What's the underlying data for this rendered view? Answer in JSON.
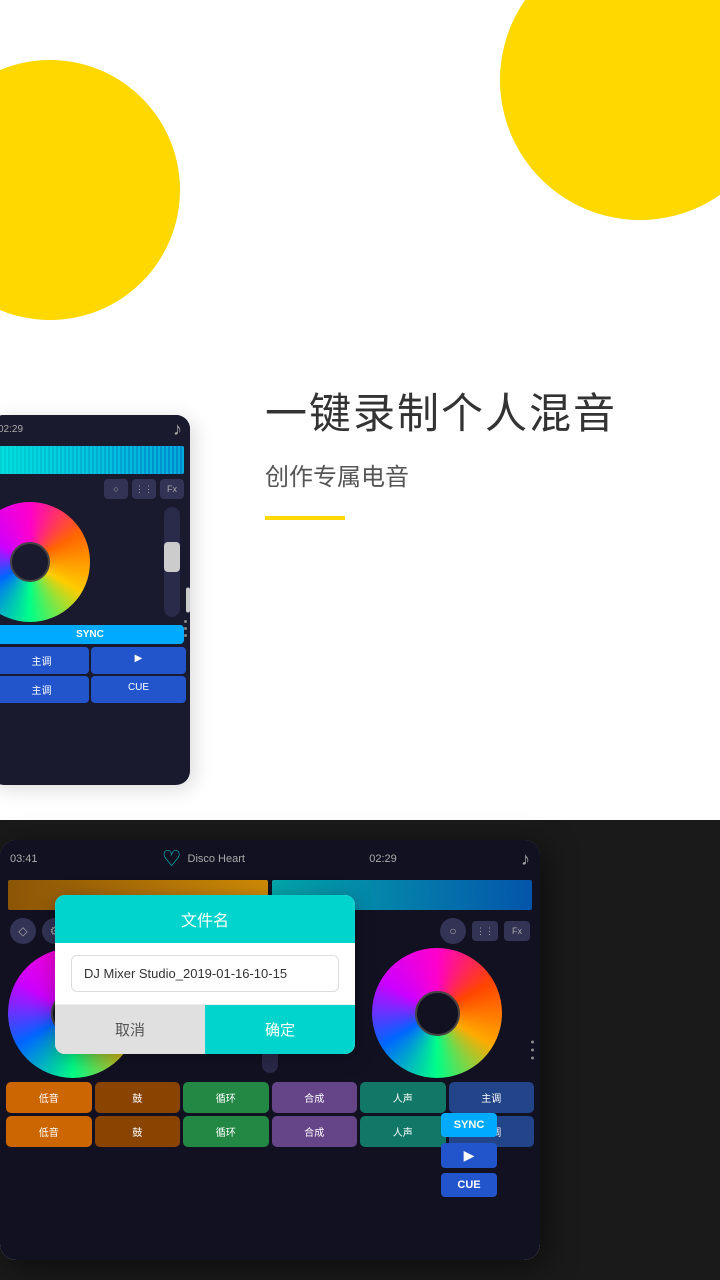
{
  "page": {
    "background_color": "#ffffff",
    "bottom_bg_color": "#1a1a1a"
  },
  "decorative": {
    "blob1": "top-right yellow circle",
    "blob2": "bottom-left yellow circle"
  },
  "top_section": {
    "main_title": "一键录制个人混音",
    "sub_title": "创作专属电音",
    "yellow_line": true
  },
  "tablet_top": {
    "time": "02:29",
    "music_icon": "♪",
    "controls": [
      "○",
      "⋮⋮",
      "Fx"
    ],
    "sync_label": "SYNC",
    "buttons": [
      {
        "label": "主调",
        "color": "blue"
      },
      {
        "label": "▶",
        "color": "blue"
      },
      {
        "label": "主调",
        "color": "blue"
      },
      {
        "label": "CUE",
        "color": "blue"
      }
    ]
  },
  "tablet_bottom": {
    "time_left": "03:41",
    "track_name": "Disco Heart",
    "time_right": "02:29",
    "music_icon": "♪",
    "icons_left": [
      "◇",
      "⚙"
    ],
    "icons_right": [
      "○",
      "⋮⋮",
      "Fx"
    ],
    "dialog": {
      "title": "文件名",
      "input_value": "DJ Mixer Studio_2019-01-16-10-15",
      "cancel_label": "取消",
      "confirm_label": "确定"
    },
    "sync_label": "SYNC",
    "play_label": "▶",
    "cue_label": "CUE",
    "pad_rows": [
      [
        "低音",
        "鼓",
        "循环",
        "合成",
        "人声",
        "主调"
      ],
      [
        "低音",
        "鼓",
        "循环",
        "合成",
        "人声",
        "主调"
      ]
    ]
  }
}
